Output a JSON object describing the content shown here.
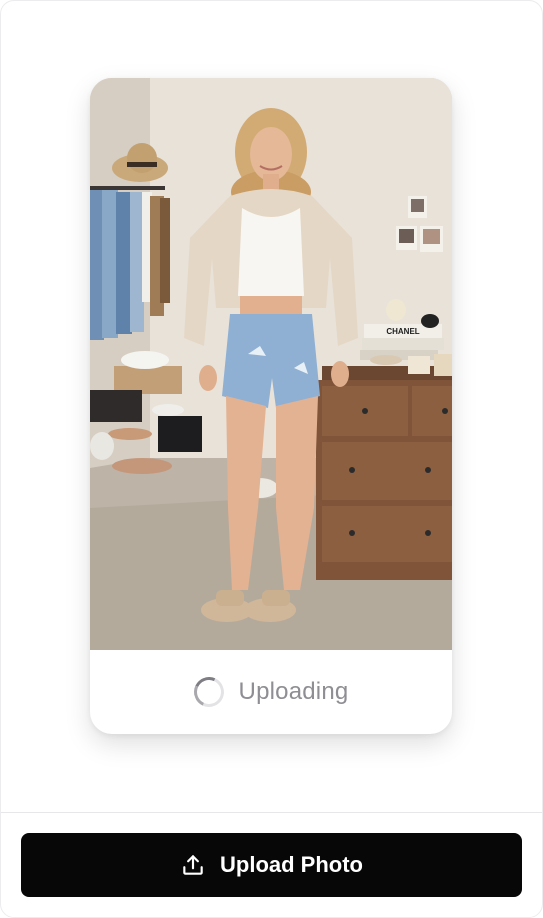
{
  "status": {
    "text": "Uploading",
    "spinner_icon": "loading-spinner-icon"
  },
  "photo": {
    "subject": "Full-length photo of a woman in a bedroom",
    "book_title": "CHANEL"
  },
  "footer": {
    "upload_label": "Upload Photo",
    "upload_icon": "upload-icon"
  },
  "colors": {
    "button_background": "#070707",
    "button_text": "#ffffff",
    "status_text": "#8e8e93",
    "card_background": "#ffffff"
  }
}
